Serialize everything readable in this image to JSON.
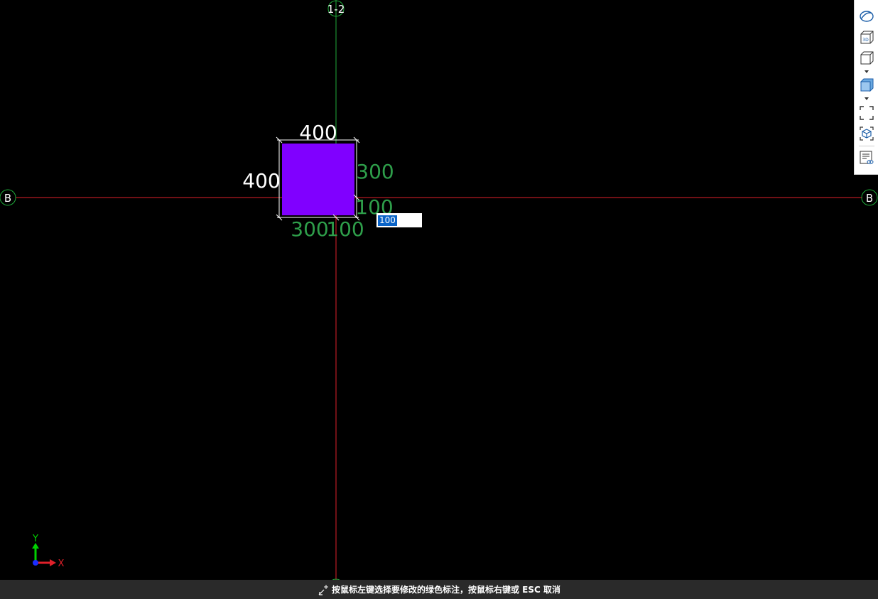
{
  "grid": {
    "vertical_axis_label": "1-2",
    "horizontal_axis_label_left": "B",
    "horizontal_axis_label_right": "B",
    "vertical_axis_color": "#1faa3a",
    "horizontal_axis_color": "#e0202a"
  },
  "column": {
    "fill_color": "#8000ff",
    "dim_top": "400",
    "dim_left": "400",
    "dim_right_upper": "300",
    "dim_right_lower": "100",
    "dim_bottom_left": "300",
    "dim_bottom_right": "100"
  },
  "dim_input": {
    "value": "100"
  },
  "ucs": {
    "y_label": "Y",
    "x_label": "X"
  },
  "view_toolbar": {
    "buttons": [
      "orbit-icon",
      "3d-view-icon",
      "wireframe-cube-icon",
      "shaded-cube-icon",
      "zoom-extents-icon",
      "zoom-object-icon",
      "display-settings-icon"
    ]
  },
  "status": {
    "message": "按鼠标左键选择要修改的绿色标注，按鼠标右键或 ESC 取消"
  },
  "colors": {
    "dimension_green": "#2e9e4a",
    "dimension_white": "#ffffff",
    "accent_blue": "#0a64c8"
  }
}
